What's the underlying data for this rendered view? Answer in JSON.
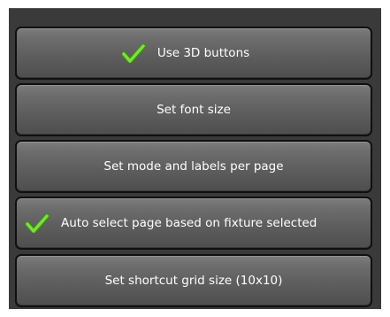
{
  "menu": {
    "items": [
      {
        "label": "Use 3D buttons",
        "checked": true,
        "icon": "checkmark-icon"
      },
      {
        "label": "Set font size",
        "checked": false
      },
      {
        "label": "Set mode and labels per page",
        "checked": false
      },
      {
        "label": "Auto select page based on fixture selected",
        "checked": true,
        "icon": "checkmark-icon"
      },
      {
        "label": "Set shortcut grid size (10x10)",
        "checked": false
      }
    ]
  },
  "colors": {
    "panel_background": "#3a3a3a",
    "button_gradient_top": "#7d7d7d",
    "button_gradient_bottom": "#4e4e4e",
    "button_border": "#101010",
    "text": "#ffffff",
    "check_green": "#6bd12a"
  }
}
